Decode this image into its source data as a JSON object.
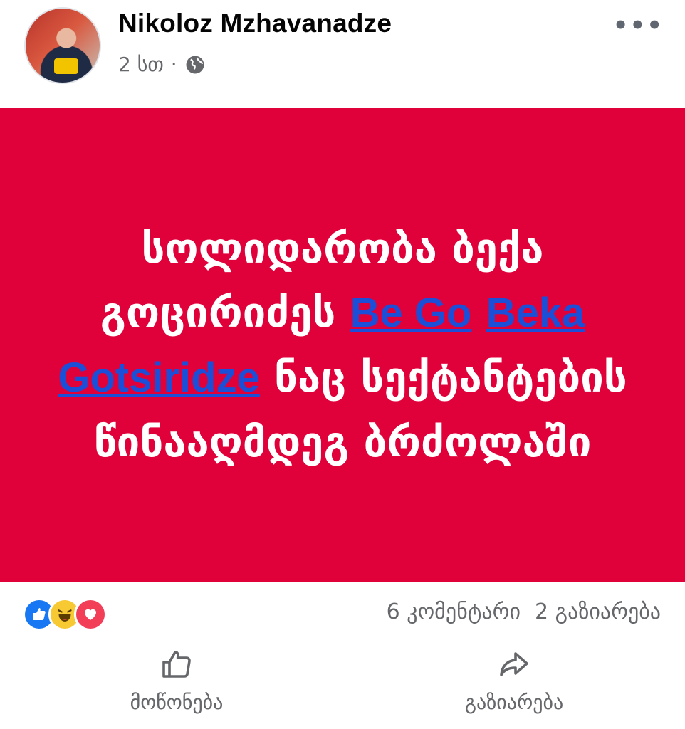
{
  "post": {
    "author": "Nikoloz Mzhavanadze",
    "time": "2 სთ",
    "separator": "·",
    "privacy_icon": "globe-icon",
    "more_icon": "•••"
  },
  "banner": {
    "background": "#e0003a",
    "text_before": "სოლიდარობა ბექა გოცირიძეს ",
    "mention_1": "Be Go",
    "mention_2": "Beka Gotsiridze",
    "text_after": " ნაც სექტანტების წინააღმდეგ ბრძოლაში"
  },
  "stats": {
    "reactions": [
      "like-reaction-icon",
      "haha-reaction-icon",
      "love-reaction-icon"
    ],
    "comments": "6 კომენტარი",
    "shares": "2 გაზიარება"
  },
  "actions": {
    "like_label": "მოწონება",
    "share_label": "გაზიარება"
  },
  "colors": {
    "accent": "#1877f2",
    "mention": "#1b4fd8",
    "muted": "#65676b"
  }
}
